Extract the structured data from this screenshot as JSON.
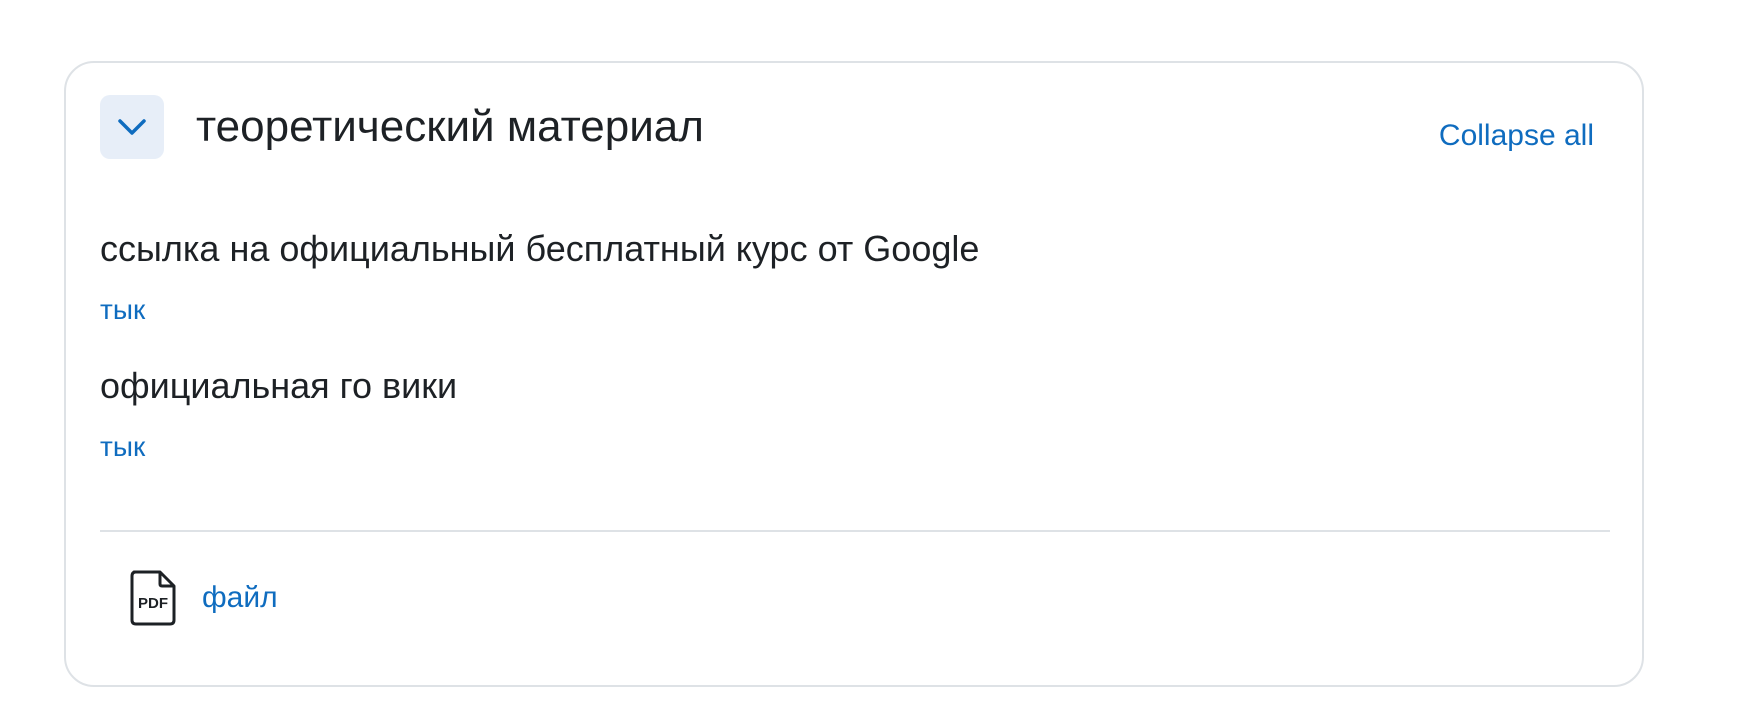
{
  "section": {
    "title": "теоретический материал",
    "toggle_icon": "chevron-down-icon",
    "collapse_all_label": "Collapse all"
  },
  "items": [
    {
      "title": "ссылка на официальный бесплатный курс от Google",
      "link_label": "тык"
    },
    {
      "title": "официальная го вики",
      "link_label": "тык"
    }
  ],
  "file": {
    "icon": "pdf-file-icon",
    "icon_text": "PDF",
    "label": "файл"
  },
  "colors": {
    "accent": "#0f6cbf",
    "text": "#1d2125",
    "border": "#dee2e6",
    "toggle_bg": "#e7eef8"
  }
}
